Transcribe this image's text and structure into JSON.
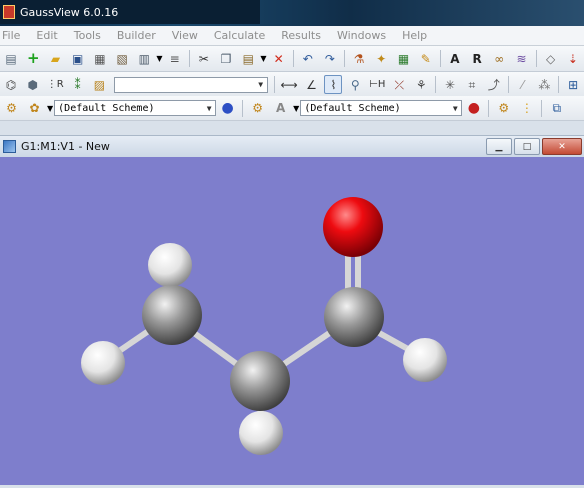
{
  "app": {
    "title": "GaussView 6.0.16"
  },
  "menu": [
    "File",
    "Edit",
    "Tools",
    "Builder",
    "View",
    "Calculate",
    "Results",
    "Windows",
    "Help"
  ],
  "toolbar3": {
    "scheme_left": "(Default Scheme)",
    "scheme_right": "(Default Scheme)"
  },
  "document": {
    "title": "G1:M1:V1 - New"
  },
  "colors": {
    "viewport": "#7e7ecc",
    "carbon": "#8c8c8c",
    "hydrogen": "#ffffff",
    "oxygen": "#e8000b"
  },
  "molecule": {
    "name": "",
    "atoms": [
      {
        "element": "C"
      },
      {
        "element": "C"
      },
      {
        "element": "C"
      },
      {
        "element": "O"
      },
      {
        "element": "H"
      },
      {
        "element": "H"
      },
      {
        "element": "H"
      },
      {
        "element": "H"
      }
    ]
  }
}
